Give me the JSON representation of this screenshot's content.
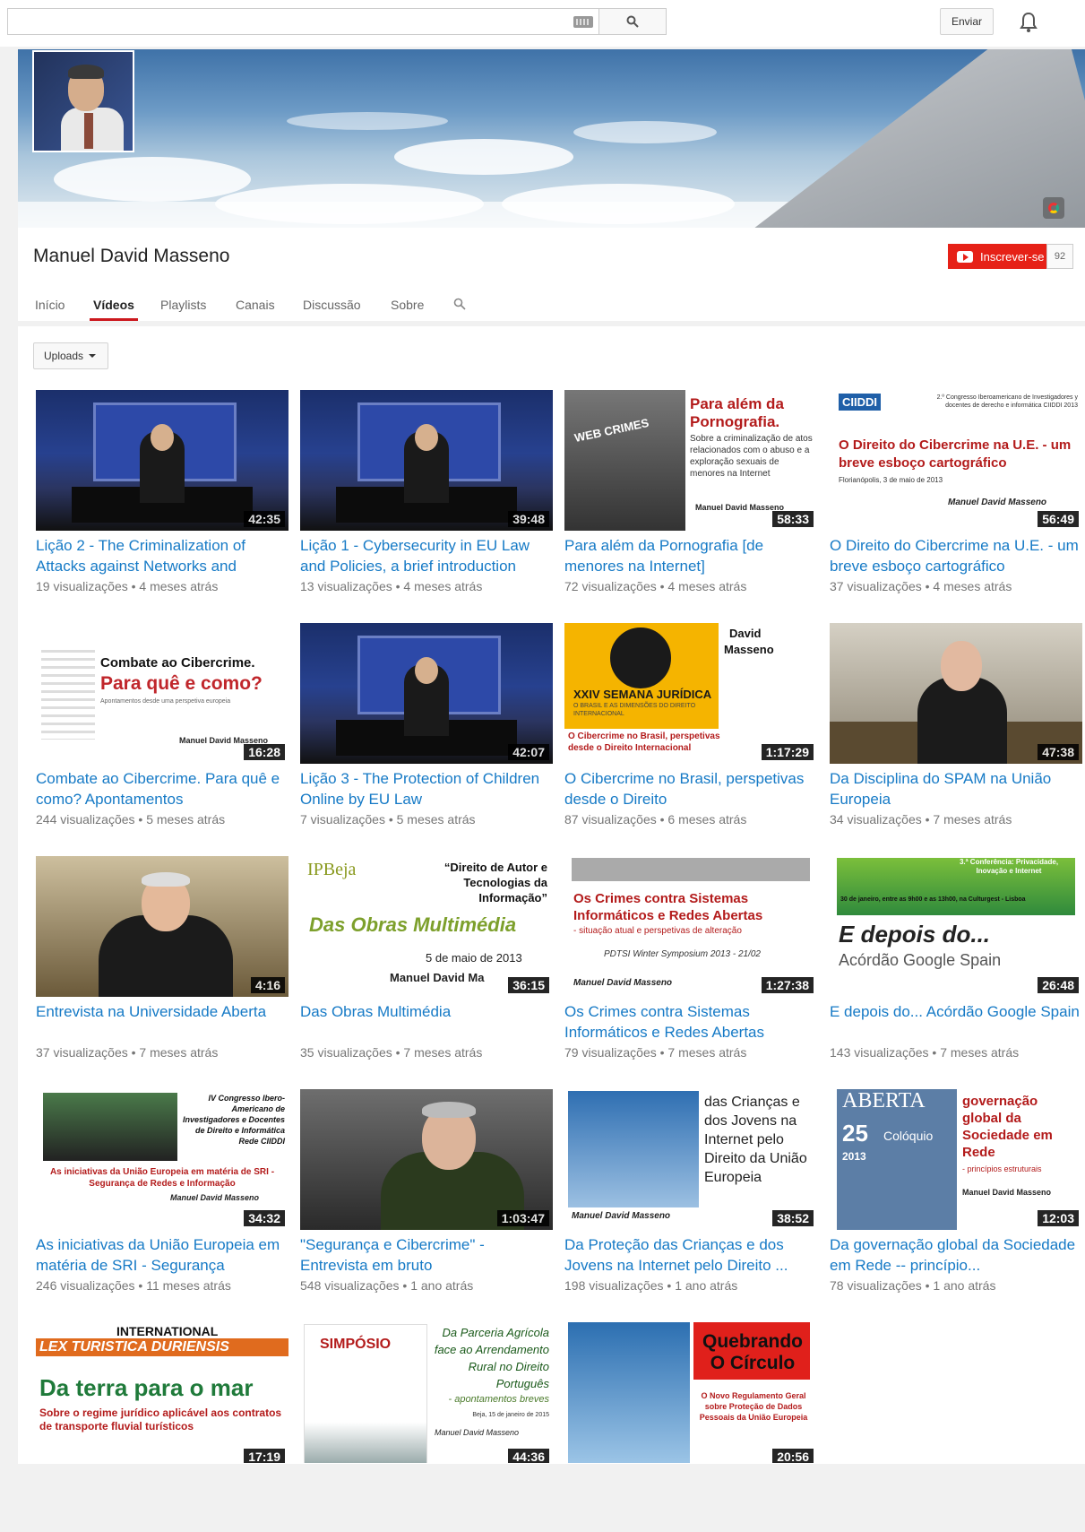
{
  "search": {
    "value": "",
    "placeholder": ""
  },
  "header": {
    "upload_label": "Enviar"
  },
  "channel": {
    "name": "Manuel David Masseno",
    "subscribe_label": "Inscrever-se",
    "subscriber_count": "92"
  },
  "tabs": [
    {
      "label": "Início"
    },
    {
      "label": "Vídeos"
    },
    {
      "label": "Playlists"
    },
    {
      "label": "Canais"
    },
    {
      "label": "Discussão"
    },
    {
      "label": "Sobre"
    }
  ],
  "filter": {
    "label": "Uploads"
  },
  "videos": [
    {
      "title": "Lição 2 - The Criminalization of Attacks against Networks and",
      "views": "19 visualizações",
      "age": "4 meses atrás",
      "duration": "42:35"
    },
    {
      "title": "Lição 1 - Cybersecurity in EU Law and Policies, a brief introduction",
      "views": "13 visualizações",
      "age": "4 meses atrás",
      "duration": "39:48"
    },
    {
      "title": "Para além da Pornografia [de menores na Internet]",
      "views": "72 visualizações",
      "age": "4 meses atrás",
      "duration": "58:33"
    },
    {
      "title": "O Direito do Cibercrime na U.E. - um breve esboço cartográfico",
      "views": "37 visualizações",
      "age": "4 meses atrás",
      "duration": "56:49"
    },
    {
      "title": "Combate ao Cibercrime. Para quê e como? Apontamentos",
      "views": "244 visualizações",
      "age": "5 meses atrás",
      "duration": "16:28"
    },
    {
      "title": "Lição 3 - The Protection of Children Online by EU Law",
      "views": "7 visualizações",
      "age": "5 meses atrás",
      "duration": "42:07"
    },
    {
      "title": "O Cibercrime no Brasil, perspetivas desde o Direito",
      "views": "87 visualizações",
      "age": "6 meses atrás",
      "duration": "1:17:29"
    },
    {
      "title": "Da Disciplina do SPAM na União Europeia",
      "views": "34 visualizações",
      "age": "7 meses atrás",
      "duration": "47:38"
    },
    {
      "title": "Entrevista na Universidade Aberta",
      "views": "37 visualizações",
      "age": "7 meses atrás",
      "duration": "4:16"
    },
    {
      "title": "Das Obras Multimédia",
      "views": "35 visualizações",
      "age": "7 meses atrás",
      "duration": "36:15"
    },
    {
      "title": "Os Crimes contra Sistemas Informáticos e Redes Abertas",
      "views": "79 visualizações",
      "age": "7 meses atrás",
      "duration": "1:27:38"
    },
    {
      "title": "E depois do... Acórdão Google Spain",
      "views": "143 visualizações",
      "age": "7 meses atrás",
      "duration": "26:48"
    },
    {
      "title": "As iniciativas da União Europeia em matéria de SRI - Segurança",
      "views": "246 visualizações",
      "age": "11 meses atrás",
      "duration": "34:32"
    },
    {
      "title": "\"Segurança e Cibercrime\" - Entrevista em bruto",
      "views": "548 visualizações",
      "age": "1 ano atrás",
      "duration": "1:03:47"
    },
    {
      "title": "Da Proteção das Crianças e dos Jovens na Internet pelo Direito ...",
      "views": "198 visualizações",
      "age": "1 ano atrás",
      "duration": "38:52"
    },
    {
      "title": "Da governação global da Sociedade em Rede -- princípio...",
      "views": "78 visualizações",
      "age": "1 ano atrás",
      "duration": "12:03"
    },
    {
      "title": "",
      "views": "",
      "age": "",
      "duration": "17:19"
    },
    {
      "title": "",
      "views": "",
      "age": "",
      "duration": "44:36"
    },
    {
      "title": "",
      "views": "",
      "age": "",
      "duration": "20:56"
    }
  ],
  "thumb_text": {
    "v3_title": "Para além da Pornografia.",
    "v3_sub": "Sobre a criminalização de atos relacionados com o abuso e a exploração sexuais de menores na Internet",
    "v3_badge": "WEB CRIMES",
    "v3_author": "Manuel David Masseno",
    "v4_logo": "CIIDDI",
    "v4_conf": "2.º Congresso Iberoamericano de Investigadores y docentes de derecho e informática CIIDDI 2013",
    "v4_title": "O Direito do Cibercrime na U.E. - um breve esboço cartográfico",
    "v4_place": "Florianópolis, 3 de maio de 2013",
    "v4_author": "Manuel David Masseno",
    "v5_title": "Combate ao Cibercrime.",
    "v5_sub": "Para quê e como?",
    "v5_note": "Apontamentos desde uma perspetiva europeia",
    "v5_author": "Manuel David Masseno",
    "v7_name1": "David",
    "v7_name2": "Masseno",
    "v7_event": "XXIV SEMANA JURÍDICA",
    "v7_event_sub": "O BRASIL E AS DIMENSÕES DO DIREITO INTERNACIONAL",
    "v7_title": "O Cibercrime no Brasil, perspetivas desde o Direito Internacional",
    "v10_logo": "IPBeja",
    "v10_quote": "“Direito de Autor e Tecnologias da Informação”",
    "v10_title": "Das Obras Multimédia",
    "v10_date": "5 de maio de 2013",
    "v10_author": "Manuel David Ma",
    "v11_title": "Os Crimes contra Sistemas Informáticos e Redes Abertas",
    "v11_sub": "- situação atual e perspetivas de alteração",
    "v11_event": "PDTSI Winter Symposium 2013 - 21/02",
    "v11_author": "Manuel David Masseno",
    "v12_conf": "3.ª Conferência: Privacidade, Inovação e Internet",
    "v12_date": "30 de janeiro, entre as 9h00 e as 13h00, na Culturgest - Lisboa",
    "v12_title": "E depois do...",
    "v12_sub": "Acórdão Google Spain",
    "v13_conf": "IV Congresso Ibero-Americano de Investigadores e Docentes de Direito e Informática Rede CIIDDI",
    "v13_title": "As iniciativas da União Europeia em matéria de SRI - Segurança de Redes e Informação",
    "v13_author": "Manuel David Masseno",
    "v15_title": "das Crianças e dos Jovens na Internet pelo Direito da União Europeia",
    "v15_author": "Manuel David Masseno",
    "v16_brand": "ABERTA",
    "v16_num": "25",
    "v16_col": "Colóquio",
    "v16_year": "2013",
    "v16_title": "governação global da Sociedade em Rede",
    "v16_sub": "- princípios estruturais",
    "v16_author": "Manuel David Masseno",
    "v17_conf": "INTERNATIONAL CONFERENCE",
    "v17_lex": "LEX TURISTICA DURIENSIS",
    "v17_title": "Da terra para o mar",
    "v17_sub": "Sobre o regime jurídico aplicável aos contratos de transporte fluvial turísticos",
    "v18_simp": "SIMPÓSIO",
    "v18_title": "Da Parceria Agrícola face ao Arrendamento Rural no Direito Português",
    "v18_sub": "- apontamentos breves",
    "v18_date": "Beja, 15 de janeiro de 2015",
    "v18_author": "Manuel David Masseno",
    "v19_title": "Quebrando O Círculo",
    "v19_sub": "O Novo Regulamento Geral sobre Proteção de Dados Pessoais da União Europeia"
  },
  "colors": {
    "link": "#167ac6",
    "subscribe": "#e62117",
    "tab_underline": "#cc181e",
    "meta": "#767676"
  },
  "icons": [
    "keyboard-icon",
    "search-icon",
    "bell-icon",
    "google-icon",
    "youtube-logo-icon",
    "caret-down-icon"
  ]
}
